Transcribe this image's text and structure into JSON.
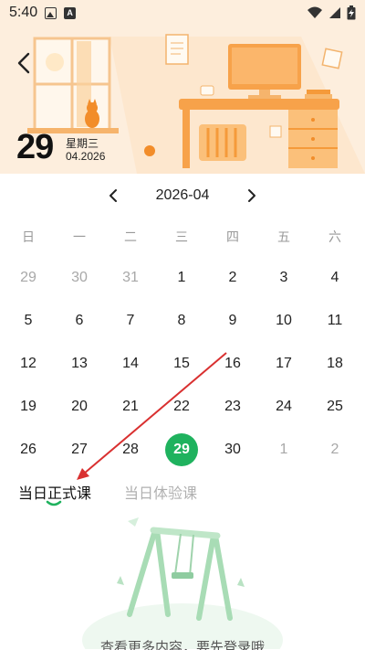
{
  "status_bar": {
    "time": "5:40",
    "icons": [
      "image-icon",
      "font-icon",
      "wifi-icon",
      "signal-icon",
      "battery-charging-icon"
    ]
  },
  "header": {
    "day_number": "29",
    "weekday": "星期三",
    "month_year": "04.2026",
    "back_icon": "chevron-left-icon"
  },
  "calendar": {
    "month_label": "2026-04",
    "prev_icon": "chevron-left-icon",
    "next_icon": "chevron-right-icon",
    "weekdays": [
      "日",
      "一",
      "二",
      "三",
      "四",
      "五",
      "六"
    ],
    "days": [
      {
        "label": "29",
        "state": "muted"
      },
      {
        "label": "30",
        "state": "muted"
      },
      {
        "label": "31",
        "state": "muted"
      },
      {
        "label": "1",
        "state": "normal"
      },
      {
        "label": "2",
        "state": "normal"
      },
      {
        "label": "3",
        "state": "normal"
      },
      {
        "label": "4",
        "state": "normal"
      },
      {
        "label": "5",
        "state": "normal"
      },
      {
        "label": "6",
        "state": "normal"
      },
      {
        "label": "7",
        "state": "normal"
      },
      {
        "label": "8",
        "state": "normal"
      },
      {
        "label": "9",
        "state": "normal"
      },
      {
        "label": "10",
        "state": "normal"
      },
      {
        "label": "11",
        "state": "normal"
      },
      {
        "label": "12",
        "state": "normal"
      },
      {
        "label": "13",
        "state": "normal"
      },
      {
        "label": "14",
        "state": "normal"
      },
      {
        "label": "15",
        "state": "normal"
      },
      {
        "label": "16",
        "state": "normal"
      },
      {
        "label": "17",
        "state": "normal"
      },
      {
        "label": "18",
        "state": "normal"
      },
      {
        "label": "19",
        "state": "normal"
      },
      {
        "label": "20",
        "state": "normal"
      },
      {
        "label": "21",
        "state": "normal"
      },
      {
        "label": "22",
        "state": "normal"
      },
      {
        "label": "23",
        "state": "normal"
      },
      {
        "label": "24",
        "state": "normal"
      },
      {
        "label": "25",
        "state": "normal"
      },
      {
        "label": "26",
        "state": "normal"
      },
      {
        "label": "27",
        "state": "normal"
      },
      {
        "label": "28",
        "state": "normal"
      },
      {
        "label": "29",
        "state": "selected"
      },
      {
        "label": "30",
        "state": "normal"
      },
      {
        "label": "1",
        "state": "muted"
      },
      {
        "label": "2",
        "state": "muted"
      }
    ],
    "selected_color": "#1fb25e"
  },
  "tabs": [
    {
      "label": "当日正式课",
      "active": true
    },
    {
      "label": "当日体验课",
      "active": false
    }
  ],
  "empty_state": {
    "message": "查看更多内容，要先登录哦"
  },
  "colors": {
    "accent": "#1fb25e",
    "header_bg": "#fdeedd",
    "annotation_arrow": "#d93030"
  }
}
